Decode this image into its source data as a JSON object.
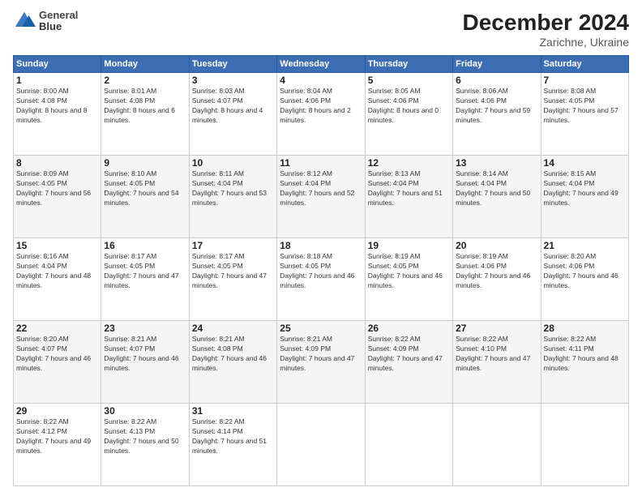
{
  "header": {
    "logo_line1": "General",
    "logo_line2": "Blue",
    "title": "December 2024",
    "subtitle": "Zarichne, Ukraine"
  },
  "days_of_week": [
    "Sunday",
    "Monday",
    "Tuesday",
    "Wednesday",
    "Thursday",
    "Friday",
    "Saturday"
  ],
  "weeks": [
    [
      {
        "day": "1",
        "sunrise": "8:00 AM",
        "sunset": "4:08 PM",
        "daylight": "8 hours and 8 minutes."
      },
      {
        "day": "2",
        "sunrise": "8:01 AM",
        "sunset": "4:08 PM",
        "daylight": "8 hours and 6 minutes."
      },
      {
        "day": "3",
        "sunrise": "8:03 AM",
        "sunset": "4:07 PM",
        "daylight": "8 hours and 4 minutes."
      },
      {
        "day": "4",
        "sunrise": "8:04 AM",
        "sunset": "4:06 PM",
        "daylight": "8 hours and 2 minutes."
      },
      {
        "day": "5",
        "sunrise": "8:05 AM",
        "sunset": "4:06 PM",
        "daylight": "8 hours and 0 minutes."
      },
      {
        "day": "6",
        "sunrise": "8:06 AM",
        "sunset": "4:06 PM",
        "daylight": "7 hours and 59 minutes."
      },
      {
        "day": "7",
        "sunrise": "8:08 AM",
        "sunset": "4:05 PM",
        "daylight": "7 hours and 57 minutes."
      }
    ],
    [
      {
        "day": "8",
        "sunrise": "8:09 AM",
        "sunset": "4:05 PM",
        "daylight": "7 hours and 56 minutes."
      },
      {
        "day": "9",
        "sunrise": "8:10 AM",
        "sunset": "4:05 PM",
        "daylight": "7 hours and 54 minutes."
      },
      {
        "day": "10",
        "sunrise": "8:11 AM",
        "sunset": "4:04 PM",
        "daylight": "7 hours and 53 minutes."
      },
      {
        "day": "11",
        "sunrise": "8:12 AM",
        "sunset": "4:04 PM",
        "daylight": "7 hours and 52 minutes."
      },
      {
        "day": "12",
        "sunrise": "8:13 AM",
        "sunset": "4:04 PM",
        "daylight": "7 hours and 51 minutes."
      },
      {
        "day": "13",
        "sunrise": "8:14 AM",
        "sunset": "4:04 PM",
        "daylight": "7 hours and 50 minutes."
      },
      {
        "day": "14",
        "sunrise": "8:15 AM",
        "sunset": "4:04 PM",
        "daylight": "7 hours and 49 minutes."
      }
    ],
    [
      {
        "day": "15",
        "sunrise": "8:16 AM",
        "sunset": "4:04 PM",
        "daylight": "7 hours and 48 minutes."
      },
      {
        "day": "16",
        "sunrise": "8:17 AM",
        "sunset": "4:05 PM",
        "daylight": "7 hours and 47 minutes."
      },
      {
        "day": "17",
        "sunrise": "8:17 AM",
        "sunset": "4:05 PM",
        "daylight": "7 hours and 47 minutes."
      },
      {
        "day": "18",
        "sunrise": "8:18 AM",
        "sunset": "4:05 PM",
        "daylight": "7 hours and 46 minutes."
      },
      {
        "day": "19",
        "sunrise": "8:19 AM",
        "sunset": "4:05 PM",
        "daylight": "7 hours and 46 minutes."
      },
      {
        "day": "20",
        "sunrise": "8:19 AM",
        "sunset": "4:06 PM",
        "daylight": "7 hours and 46 minutes."
      },
      {
        "day": "21",
        "sunrise": "8:20 AM",
        "sunset": "4:06 PM",
        "daylight": "7 hours and 46 minutes."
      }
    ],
    [
      {
        "day": "22",
        "sunrise": "8:20 AM",
        "sunset": "4:07 PM",
        "daylight": "7 hours and 46 minutes."
      },
      {
        "day": "23",
        "sunrise": "8:21 AM",
        "sunset": "4:07 PM",
        "daylight": "7 hours and 46 minutes."
      },
      {
        "day": "24",
        "sunrise": "8:21 AM",
        "sunset": "4:08 PM",
        "daylight": "7 hours and 46 minutes."
      },
      {
        "day": "25",
        "sunrise": "8:21 AM",
        "sunset": "4:09 PM",
        "daylight": "7 hours and 47 minutes."
      },
      {
        "day": "26",
        "sunrise": "8:22 AM",
        "sunset": "4:09 PM",
        "daylight": "7 hours and 47 minutes."
      },
      {
        "day": "27",
        "sunrise": "8:22 AM",
        "sunset": "4:10 PM",
        "daylight": "7 hours and 47 minutes."
      },
      {
        "day": "28",
        "sunrise": "8:22 AM",
        "sunset": "4:11 PM",
        "daylight": "7 hours and 48 minutes."
      }
    ],
    [
      {
        "day": "29",
        "sunrise": "8:22 AM",
        "sunset": "4:12 PM",
        "daylight": "7 hours and 49 minutes."
      },
      {
        "day": "30",
        "sunrise": "8:22 AM",
        "sunset": "4:13 PM",
        "daylight": "7 hours and 50 minutes."
      },
      {
        "day": "31",
        "sunrise": "8:22 AM",
        "sunset": "4:14 PM",
        "daylight": "7 hours and 51 minutes."
      },
      null,
      null,
      null,
      null
    ]
  ]
}
